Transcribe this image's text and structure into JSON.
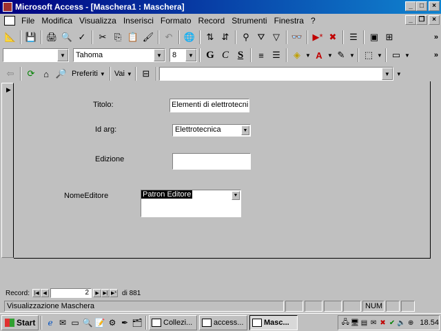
{
  "window": {
    "title": "Microsoft Access - [Maschera1 : Maschera]",
    "min": "_",
    "max": "□",
    "close": "×"
  },
  "menu": {
    "items": [
      "File",
      "Modifica",
      "Visualizza",
      "Inserisci",
      "Formato",
      "Record",
      "Strumenti",
      "Finestra",
      "?"
    ],
    "mdi_min": "_",
    "mdi_restore": "❐",
    "mdi_close": "×"
  },
  "formatting": {
    "object_combo": "",
    "font": "Tahoma",
    "size": "8",
    "bold": "G",
    "italic": "C",
    "underline": "S"
  },
  "web": {
    "favorites": "Preferiti",
    "goto": "Vai",
    "address": ""
  },
  "form": {
    "titolo_label": "Titolo:",
    "titolo_value": "Elementi di elettrotecni",
    "idarg_label": "Id arg:",
    "idarg_value": "Elettrotecnica",
    "edizione_label": "Edizione",
    "edizione_value": "",
    "editore_label": "NomeEditore",
    "editore_value": "Patron Editore"
  },
  "navigation": {
    "record_label": "Record:",
    "current": "2",
    "of_label": "di 881"
  },
  "status": {
    "text": "Visualizzazione Maschera",
    "num": "NUM"
  },
  "taskbar": {
    "start": "Start",
    "tasks": [
      "Collezi...",
      "access...",
      "Masc..."
    ],
    "clock": "18.54"
  }
}
